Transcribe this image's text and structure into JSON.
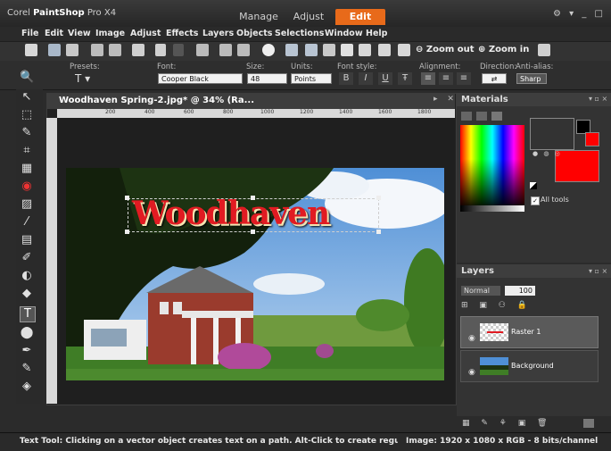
{
  "app": {
    "brand_prefix": "Corel",
    "brand_name": "PaintShop",
    "brand_suffix": "Pro X4"
  },
  "workspace_tabs": [
    {
      "label": "Manage",
      "active": false
    },
    {
      "label": "Adjust",
      "active": false
    },
    {
      "label": "Edit",
      "active": true
    }
  ],
  "window_controls": "⚙ ▾ _ □ ×",
  "menu": [
    {
      "label": "File"
    },
    {
      "label": "Edit"
    },
    {
      "label": "View"
    },
    {
      "label": "Image"
    },
    {
      "label": "Adjust"
    },
    {
      "label": "Effects"
    },
    {
      "label": "Layers"
    },
    {
      "label": "Objects"
    },
    {
      "label": "Selections"
    },
    {
      "label": "Window"
    },
    {
      "label": "Help"
    }
  ],
  "toolbar": {
    "zoom_out_label": "Zoom out",
    "zoom_in_label": "Zoom in"
  },
  "tool_options": {
    "presets_label": "Presets:",
    "font_label": "Font:",
    "font_value": "Cooper Black",
    "size_label": "Size:",
    "size_value": "48",
    "units_label": "Units:",
    "units_value": "Points",
    "font_style_label": "Font style:",
    "bold": "B",
    "italic": "I",
    "underline": "U",
    "strike": "Ŧ",
    "alignment_label": "Alignment:",
    "direction_label": "Direction:",
    "antialias_label": "Anti-alias:",
    "antialias_value": "Sharp"
  },
  "document": {
    "title": "Woodhaven Spring-2.jpg* @  34% (Ra...",
    "ruler_ticks": [
      "200",
      "400",
      "600",
      "800",
      "1000",
      "1200",
      "1400",
      "1600",
      "1800"
    ],
    "vector_text": "Woodhaven"
  },
  "materials": {
    "title": "Materials",
    "all_tools_label": "All tools",
    "all_tools_checked": true,
    "foreground": "#000000",
    "background": "#ff0000"
  },
  "layers": {
    "title": "Layers",
    "blend_mode": "Normal",
    "opacity": "100",
    "items": [
      {
        "name": "Raster 1",
        "selected": true
      },
      {
        "name": "Background",
        "selected": false
      }
    ]
  },
  "status": {
    "text": "Text Tool: Clicking on a vector object creates text on a path. Alt-Click to create regular text on",
    "info": "Image:  1920 x 1080 x RGB - 8 bits/channel"
  }
}
